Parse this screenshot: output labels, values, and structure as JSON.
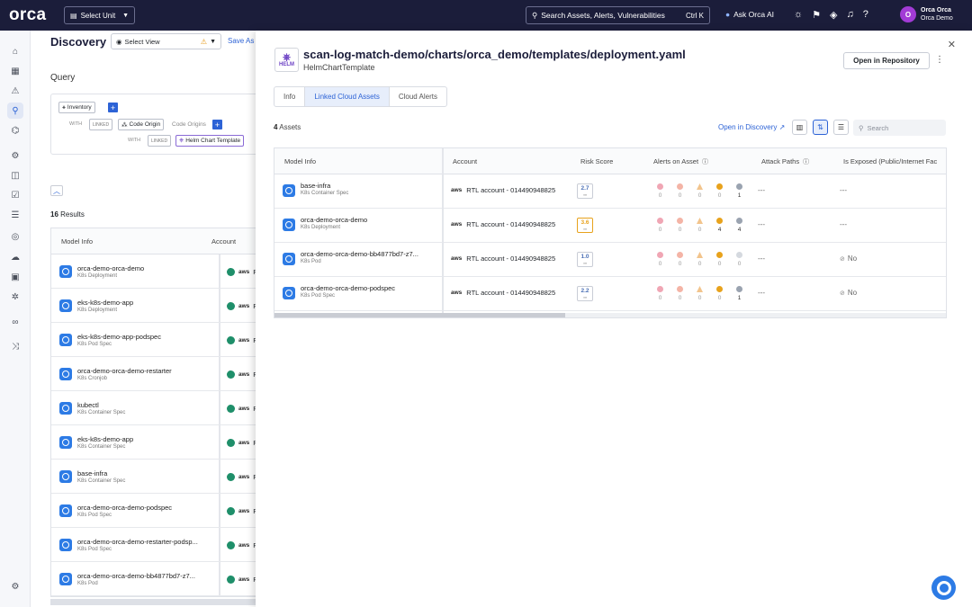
{
  "topbar": {
    "logo": "orca",
    "select_unit": "Select Unit",
    "search_placeholder": "Search Assets, Alerts, Vulnerabilities",
    "search_shortcut": "Ctrl K",
    "ask_ai": "Ask Orca AI",
    "user_initial": "O",
    "user_name": "Orca Orca",
    "user_org": "Orca Demo"
  },
  "discovery": {
    "title": "Discovery",
    "select_view": "Select View",
    "save_as": "Save As",
    "query_label": "Query",
    "query": {
      "inventory": "Inventory",
      "with1": "WITH",
      "linked1": "LINKED",
      "code_origin": "Code Origin",
      "code_origins": "Code Origins",
      "with2": "WITH",
      "linked2": "LINKED",
      "helm_chart_template": "Helm Chart Template"
    },
    "results_count": "16",
    "results_label": "Results",
    "table_headers": [
      "Model Info",
      "Account"
    ],
    "rows": [
      {
        "title": "orca-demo-orca-demo",
        "sub": "K8s Deployment",
        "account": "RTL"
      },
      {
        "title": "eks-k8s-demo-app",
        "sub": "K8s Deployment",
        "account": "RTL"
      },
      {
        "title": "eks-k8s-demo-app-podspec",
        "sub": "K8s Pod Spec",
        "account": "RTL"
      },
      {
        "title": "orca-demo-orca-demo-restarter",
        "sub": "K8s Cronjob",
        "account": "RTL"
      },
      {
        "title": "kubectl",
        "sub": "K8s Container Spec",
        "account": "RTL"
      },
      {
        "title": "eks-k8s-demo-app",
        "sub": "K8s Container Spec",
        "account": "RTL"
      },
      {
        "title": "base-infra",
        "sub": "K8s Container Spec",
        "account": "RTL"
      },
      {
        "title": "orca-demo-orca-demo-podspec",
        "sub": "K8s Pod Spec",
        "account": "RTL"
      },
      {
        "title": "orca-demo-orca-demo-restarter-podsp...",
        "sub": "K8s Pod Spec",
        "account": "RTL"
      },
      {
        "title": "orca-demo-orca-demo-bb4877bd7-z7...",
        "sub": "K8s Pod",
        "account": "RTL"
      }
    ]
  },
  "panel": {
    "icon_label": "HELM",
    "title": "scan-log-match-demo/charts/orca_demo/templates/deployment.yaml",
    "subtitle": "HelmChartTemplate",
    "open_repo": "Open in Repository",
    "tabs": [
      "Info",
      "Linked Cloud Assets",
      "Cloud Alerts"
    ],
    "asset_count": "4",
    "asset_label": "Assets",
    "open_discovery": "Open in Discovery",
    "search_placeholder": "Search",
    "headers": [
      "Model Info",
      "Account",
      "Risk Score",
      "Alerts on Asset",
      "Attack Paths",
      "Is Exposed (Public/Internet Fac"
    ],
    "rows": [
      {
        "title": "base-infra",
        "sub": "K8s Container Spec",
        "account": "RTL account - 014490948825",
        "risk": "2.7",
        "alerts": [
          "0",
          "0",
          "0",
          "0",
          "1"
        ],
        "attack": "---",
        "exposed": "---"
      },
      {
        "title": "orca-demo-orca-demo",
        "sub": "K8s Deployment",
        "account": "RTL account - 014490948825",
        "risk": "3.6",
        "alerts": [
          "0",
          "0",
          "0",
          "4",
          "4"
        ],
        "attack": "---",
        "exposed": "---"
      },
      {
        "title": "orca-demo-orca-demo-bb4877bd7-z7...",
        "sub": "K8s Pod",
        "account": "RTL account - 014490948825",
        "risk": "1.0",
        "alerts": [
          "0",
          "0",
          "0",
          "0",
          "0"
        ],
        "attack": "---",
        "exposed": "No"
      },
      {
        "title": "orca-demo-orca-demo-podspec",
        "sub": "K8s Pod Spec",
        "account": "RTL account - 014490948825",
        "risk": "2.2",
        "alerts": [
          "0",
          "0",
          "0",
          "0",
          "1"
        ],
        "attack": "---",
        "exposed": "No"
      }
    ]
  },
  "colors": {
    "topbar": "#1b1d3a",
    "accent": "#2d63d6",
    "alert_critical": "#f0a6b4",
    "alert_high": "#f4b4a6",
    "alert_medium": "#f2c48c",
    "alert_low": "#e8a21c",
    "alert_info": "#9aa3b0"
  }
}
